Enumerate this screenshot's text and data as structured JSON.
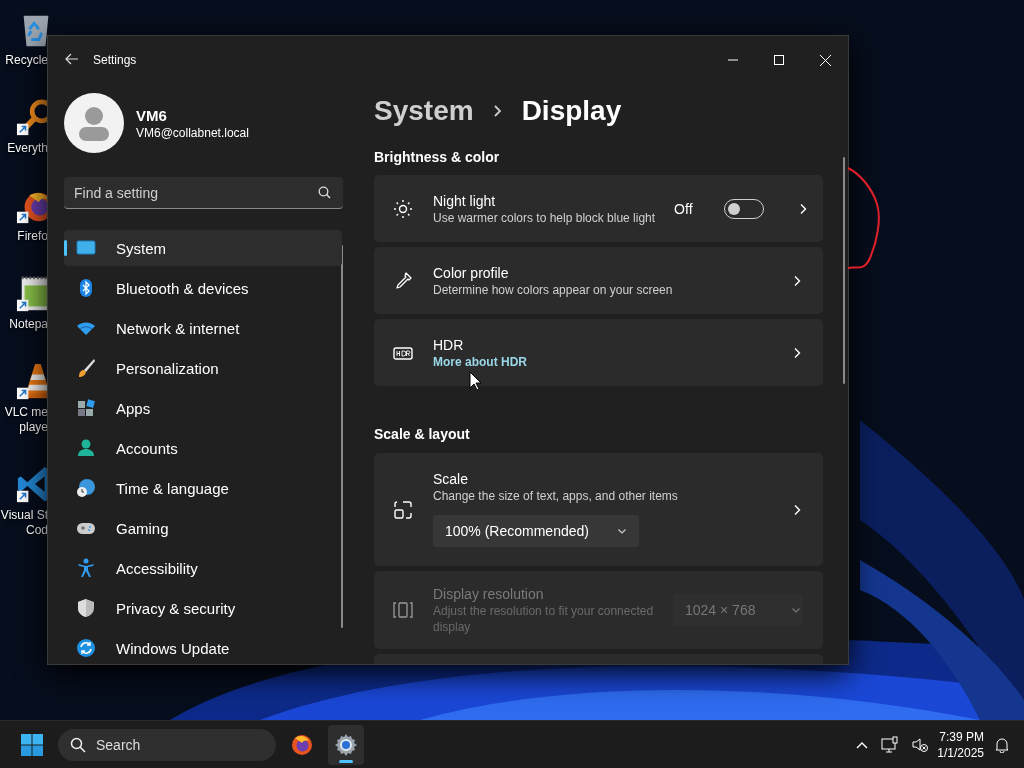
{
  "desktop_icons": [
    {
      "kind": "recycle-bin",
      "lines": [
        "Recycle"
      ],
      "shortcut": false
    },
    {
      "kind": "search-tool",
      "lines": [
        "Everyth"
      ],
      "shortcut": true
    },
    {
      "kind": "browser",
      "lines": [
        "Firefo"
      ],
      "shortcut": true
    },
    {
      "kind": "notepad",
      "lines": [
        "Notepa"
      ],
      "shortcut": true
    },
    {
      "kind": "media-player",
      "lines": [
        "VLC me",
        "playe"
      ],
      "shortcut": true
    },
    {
      "kind": "code-editor",
      "lines": [
        "Visual St",
        "Cod"
      ],
      "shortcut": true
    }
  ],
  "window": {
    "title": "Settings",
    "user": {
      "name": "VM6",
      "email": "VM6@collabnet.local"
    },
    "search": {
      "placeholder": "Find a setting"
    },
    "nav": [
      {
        "kind": "system",
        "label": "System",
        "selected": true
      },
      {
        "kind": "bluetooth",
        "label": "Bluetooth & devices",
        "selected": false
      },
      {
        "kind": "network",
        "label": "Network & internet",
        "selected": false
      },
      {
        "kind": "personalization",
        "label": "Personalization",
        "selected": false
      },
      {
        "kind": "apps",
        "label": "Apps",
        "selected": false
      },
      {
        "kind": "accounts",
        "label": "Accounts",
        "selected": false
      },
      {
        "kind": "time",
        "label": "Time & language",
        "selected": false
      },
      {
        "kind": "gaming",
        "label": "Gaming",
        "selected": false
      },
      {
        "kind": "accessibility",
        "label": "Accessibility",
        "selected": false
      },
      {
        "kind": "privacy",
        "label": "Privacy & security",
        "selected": false
      },
      {
        "kind": "update",
        "label": "Windows Update",
        "selected": false
      }
    ],
    "breadcrumb": [
      "System",
      "Display"
    ],
    "sections": [
      {
        "title": "Brightness & color",
        "cards": [
          {
            "kind": "toggle",
            "title": "Night light",
            "description": "Use warmer colors to help block blue light",
            "state_label": "Off",
            "on": false
          },
          {
            "kind": "plain",
            "title": "Color profile",
            "description": "Determine how colors appear on your screen"
          },
          {
            "kind": "link",
            "title": "HDR",
            "link": "More about HDR"
          }
        ]
      },
      {
        "title": "Scale & layout",
        "cards": [
          {
            "kind": "dropdown-below",
            "title": "Scale",
            "description": "Change the size of text, apps, and other items",
            "value": "100% (Recommended)",
            "disabled": false
          },
          {
            "kind": "dropdown-right",
            "title": "Display resolution",
            "description": "Adjust the resolution to fit your connected display",
            "value": "1024 × 768",
            "disabled": true
          }
        ]
      }
    ]
  },
  "taskbar": {
    "search": {
      "placeholder": "Search"
    },
    "apps": [
      {
        "kind": "browser",
        "selected": false
      },
      {
        "kind": "settings",
        "selected": true
      }
    ],
    "time": "7:39 PM",
    "date": "1/1/2025"
  }
}
